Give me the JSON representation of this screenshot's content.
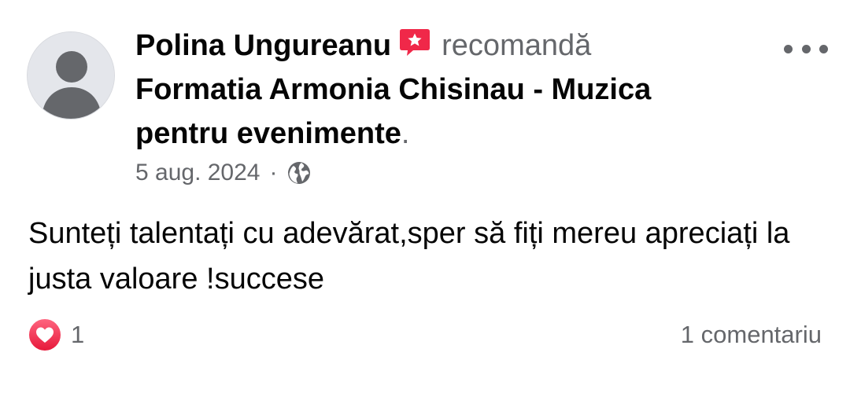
{
  "post": {
    "author": "Polina Ungureanu",
    "badge_icon": "recommendation-star-icon",
    "verb": "recomandă",
    "page_name": "Formatia Armonia Chisinau - Muzica pentru evenimente",
    "page_name_suffix": ".",
    "date": "5 aug. 2024",
    "separator": "·",
    "privacy_icon": "globe-icon",
    "text": "Sunteți talentați cu adevărat,sper să fiți mereu apreciați la justa valoare !succese",
    "more_icon": "more-options-icon"
  },
  "footer": {
    "reaction_icon": "love-reaction-icon",
    "reaction_count": "1",
    "comments_label": "1 comentariu"
  },
  "colors": {
    "text_primary": "#050505",
    "text_secondary": "#65676b",
    "badge_red": "#f02849",
    "heart_red": "#f33e58",
    "avatar_bg": "#e4e6eb"
  }
}
